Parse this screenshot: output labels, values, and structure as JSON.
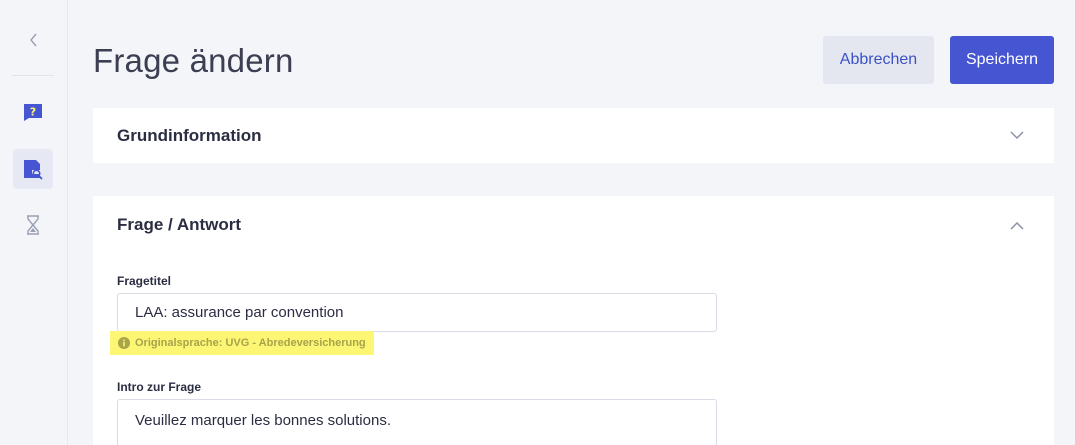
{
  "page": {
    "title": "Frage ändern",
    "cancel_label": "Abbrechen",
    "save_label": "Speichern"
  },
  "sidebar": {
    "items": [
      {
        "name": "back",
        "icon": "chevron-left-icon"
      },
      {
        "name": "questions",
        "icon": "question-icon",
        "color": "#4655d1"
      },
      {
        "name": "search-questions",
        "icon": "document-search-icon",
        "color": "#4655d1",
        "active": true
      },
      {
        "name": "timer",
        "icon": "hourglass-icon",
        "color": "#9aa0b4"
      }
    ]
  },
  "sections": {
    "grund": {
      "title": "Grundinformation",
      "expanded": false
    },
    "frage": {
      "title": "Frage / Antwort",
      "expanded": true,
      "fields": {
        "titel_label": "Fragetitel",
        "titel_value": "LAA: assurance par convention",
        "original_hint": "Originalsprache: UVG - Abredeversicherung",
        "intro_label": "Intro zur Frage",
        "intro_value": "Veuillez marquer les bonnes solutions."
      }
    }
  },
  "colors": {
    "primary": "#4655d1",
    "highlight": "#fdf675",
    "background": "#f4f5f8"
  }
}
